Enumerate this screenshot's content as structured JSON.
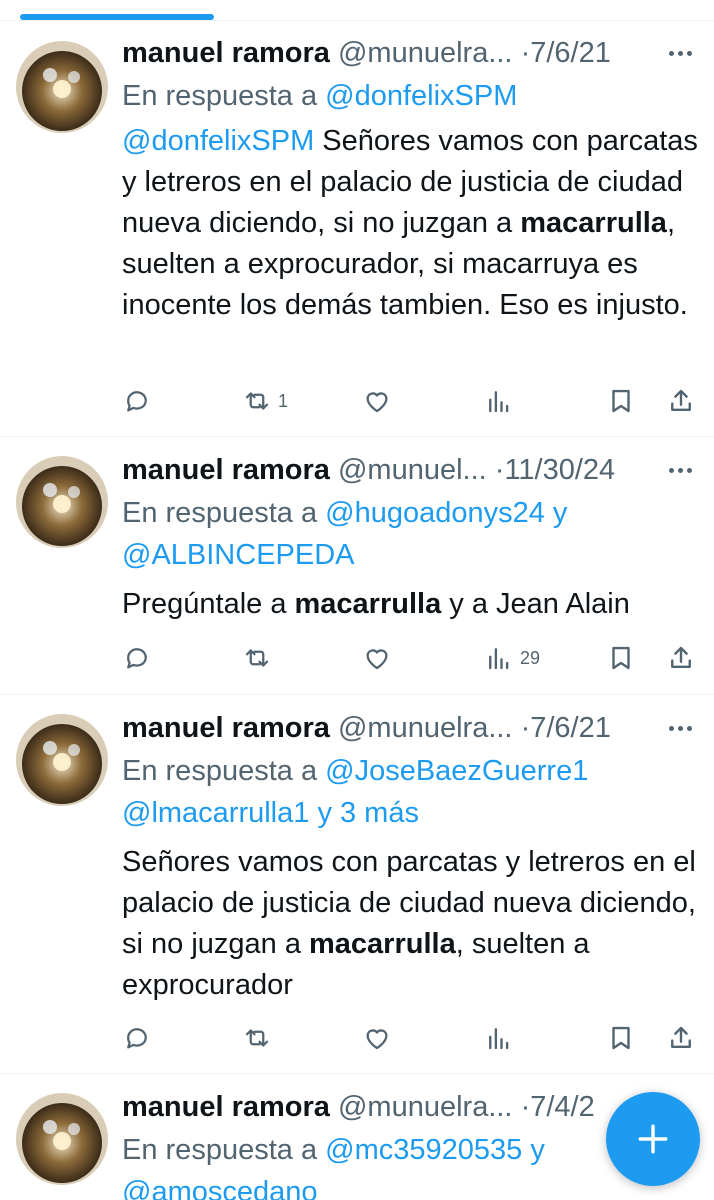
{
  "tweets": [
    {
      "name": "manuel ramora",
      "handle": "@munuelra...",
      "sep": "·",
      "date": "7/6/21",
      "reply_prefix": "En respuesta a",
      "reply_line1": "@donfelixSPM",
      "reply_line2": "",
      "body": {
        "mention": "@donfelixSPM",
        "part1": " Señores vamos con parcatas y letreros en el palacio de justicia de ciudad nueva diciendo, si no juzgan a ",
        "bold": "macarrulla",
        "part2": ", suelten a exprocurador, si macarruya es inocente los demás tambien. Eso es injusto."
      },
      "retweet_count": "1",
      "views_count": ""
    },
    {
      "name": "manuel ramora",
      "handle": "@munuel...",
      "sep": "·",
      "date": "11/30/24",
      "reply_prefix": "En respuesta a",
      "reply_line1": "@hugoadonys24 y",
      "reply_line2": "@ALBINCEPEDA",
      "body": {
        "mention": "",
        "part1": "Pregúntale a ",
        "bold": "macarrulla",
        "part2": " y a Jean Alain"
      },
      "retweet_count": "",
      "views_count": "29"
    },
    {
      "name": "manuel ramora",
      "handle": "@munuelra...",
      "sep": "·",
      "date": "7/6/21",
      "reply_prefix": "En respuesta a",
      "reply_line1": "@JoseBaezGuerre1",
      "reply_line2": "@lmacarrulla1 y 3 más",
      "body": {
        "mention": "",
        "part1": "Señores vamos con parcatas y letreros en el palacio de justicia de ciudad nueva diciendo, si no juzgan a ",
        "bold": "macarrulla",
        "part2": ", suelten a exprocurador"
      },
      "retweet_count": "",
      "views_count": ""
    },
    {
      "name": "manuel ramora",
      "handle": "@munuelra...",
      "sep": "·",
      "date": "7/4/2",
      "reply_prefix": "En respuesta a",
      "reply_line1": "@mc35920535 y",
      "reply_line2": "@amoscedano"
    }
  ],
  "icons": {
    "reply": "reply-icon",
    "retweet": "retweet-icon",
    "like": "like-icon",
    "views": "views-icon",
    "bookmark": "bookmark-icon",
    "share": "share-icon",
    "compose": "plus-icon"
  },
  "colors": {
    "accent": "#1d9bf0",
    "secondary_text": "#536471",
    "primary_text": "#0f1419"
  }
}
